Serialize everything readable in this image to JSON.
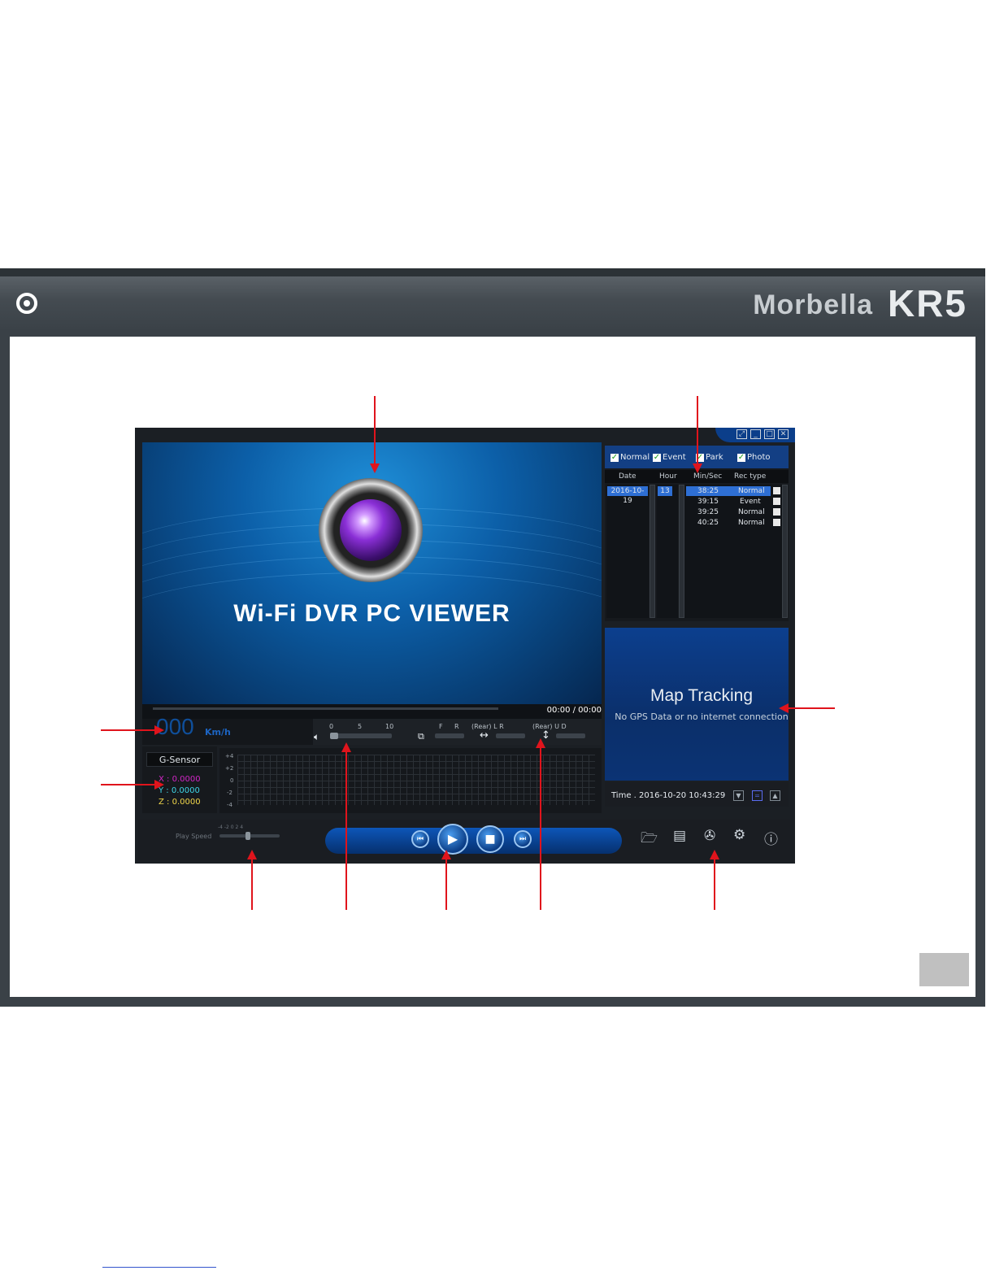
{
  "header": {
    "brand": "Morbella",
    "model": "KR5"
  },
  "viewer": {
    "title": "Wi-Fi DVR PC VIEWER",
    "time_readout": "00:00 / 00:00",
    "speed": {
      "value": "000",
      "unit": "Km/h"
    },
    "volume_scale": [
      "0",
      "5",
      "10"
    ],
    "flip_labels": {
      "front_rear": [
        "F",
        "R"
      ],
      "mirror": "(Rear) L   R",
      "vertical": "(Rear) U   D"
    },
    "gsensor": {
      "label": "G-Sensor",
      "x": "X : 0.0000",
      "y": "Y : 0.0000",
      "z": "Z : 0.0000",
      "y_ticks": [
        "+4",
        "+2",
        "0",
        "-2",
        "-4"
      ]
    },
    "play_speed": {
      "label": "Play Speed",
      "scale": "-4  -2  0  2  4"
    },
    "filters": [
      {
        "label": "Normal",
        "checked": true
      },
      {
        "label": "Event",
        "checked": true
      },
      {
        "label": "Park",
        "checked": true
      },
      {
        "label": "Photo",
        "checked": true
      }
    ],
    "columns": [
      "Date",
      "Hour",
      "Min/Sec",
      "Rec type"
    ],
    "date_selected": "2016-10-19",
    "hour_selected": "13",
    "recordings": [
      {
        "min_sec": "38:25",
        "type": "Normal",
        "selected": true
      },
      {
        "min_sec": "39:15",
        "type": "Event",
        "selected": false
      },
      {
        "min_sec": "39:25",
        "type": "Normal",
        "selected": false
      },
      {
        "min_sec": "40:25",
        "type": "Normal",
        "selected": false
      }
    ],
    "map": {
      "title": "Map Tracking",
      "subtitle": "No GPS Data or no internet connection"
    },
    "time_label": "Time . 2016-10-20 10:43:29"
  },
  "colors": {
    "arrow": "#e0141c",
    "frame": "#3a4147",
    "accent_blue": "#0b3e8a"
  }
}
